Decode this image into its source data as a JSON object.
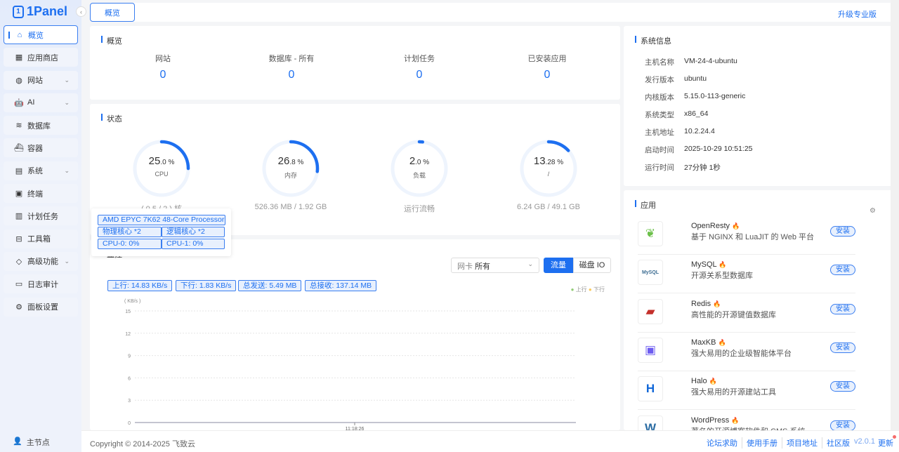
{
  "brand": "1Panel",
  "sidebar": {
    "items": [
      {
        "label": "概览",
        "icon": "home-icon"
      },
      {
        "label": "应用商店",
        "icon": "grid-icon"
      },
      {
        "label": "网站",
        "icon": "globe-icon",
        "expand": true
      },
      {
        "label": "AI",
        "icon": "robot-icon",
        "expand": true
      },
      {
        "label": "数据库",
        "icon": "database-icon"
      },
      {
        "label": "容器",
        "icon": "docker-icon"
      },
      {
        "label": "系统",
        "icon": "system-icon",
        "expand": true
      },
      {
        "label": "终端",
        "icon": "terminal-icon"
      },
      {
        "label": "计划任务",
        "icon": "calendar-icon"
      },
      {
        "label": "工具箱",
        "icon": "toolbox-icon"
      },
      {
        "label": "高级功能",
        "icon": "diamond-icon",
        "expand": true
      },
      {
        "label": "日志审计",
        "icon": "log-icon"
      },
      {
        "label": "面板设置",
        "icon": "gear-icon"
      }
    ],
    "node": "主节点"
  },
  "topbar": {
    "tab": "概览",
    "upgrade": "升级专业版"
  },
  "overview": {
    "title": "概览",
    "stats": [
      {
        "label": "网站",
        "value": "0"
      },
      {
        "label": "数据库 - 所有",
        "value": "0"
      },
      {
        "label": "计划任务",
        "value": "0"
      },
      {
        "label": "已安装应用",
        "value": "0"
      }
    ]
  },
  "status": {
    "title": "状态",
    "gauges": [
      {
        "int": "25",
        "dec": ".0 %",
        "label": "CPU",
        "sub": "( 0.5 / 2 ) 核",
        "percent": 25
      },
      {
        "int": "26",
        "dec": ".8 %",
        "label": "内存",
        "sub": "526.36 MB / 1.92 GB",
        "percent": 26.8
      },
      {
        "int": "2",
        "dec": ".0 %",
        "label": "负载",
        "sub": "运行流畅",
        "percent": 2
      },
      {
        "int": "13",
        "dec": ".28 %",
        "label": "/",
        "sub": "6.24 GB / 49.1 GB",
        "percent": 13.28
      }
    ],
    "accent": "#1d6ff0"
  },
  "cpu_tooltip": {
    "model": "AMD EPYC 7K62 48-Core Processor",
    "physical": "物理核心 *2",
    "logical": "逻辑核心 *2",
    "cpu0": "CPU-0: 0%",
    "cpu1": "CPU-1: 0%"
  },
  "monitor": {
    "title": "监控",
    "nic_label": "网卡",
    "nic_value": "所有",
    "btn_traffic": "流量",
    "btn_disk": "磁盘 IO",
    "tags": [
      "上行: 14.83 KB/s",
      "下行: 1.83 KB/s",
      "总发送: 5.49 MB",
      "总接收: 137.14 MB"
    ]
  },
  "chart_data": {
    "type": "line",
    "ylabel": "( KB/s )",
    "ylim": [
      0,
      15
    ],
    "yticks": [
      "15",
      "12",
      "9",
      "6",
      "3",
      "0"
    ],
    "x": [
      "11:18:26"
    ],
    "series": [
      {
        "name": "上行",
        "values": [
          0
        ],
        "color": "#91cc75"
      },
      {
        "name": "下行",
        "values": [
          0
        ],
        "color": "#fac858"
      }
    ],
    "grid": true,
    "legend": "top-right"
  },
  "sysinfo": {
    "title": "系统信息",
    "rows": [
      {
        "k": "主机名称",
        "v": "VM-24-4-ubuntu"
      },
      {
        "k": "发行版本",
        "v": "ubuntu"
      },
      {
        "k": "内核版本",
        "v": "5.15.0-113-generic"
      },
      {
        "k": "系统类型",
        "v": "x86_64"
      },
      {
        "k": "主机地址",
        "v": "10.2.24.4"
      },
      {
        "k": "启动时间",
        "v": "2025-10-29 10:51:25"
      },
      {
        "k": "运行时间",
        "v": "27分钟 1秒"
      }
    ]
  },
  "apps": {
    "title": "应用",
    "install": "安装",
    "items": [
      {
        "name": "OpenResty",
        "desc": "基于 NGINX 和 LuaJIT 的 Web 平台"
      },
      {
        "name": "MySQL",
        "desc": "开源关系型数据库"
      },
      {
        "name": "Redis",
        "desc": "高性能的开源键值数据库"
      },
      {
        "name": "MaxKB",
        "desc": "强大易用的企业级智能体平台"
      },
      {
        "name": "Halo",
        "desc": "强大易用的开源建站工具"
      },
      {
        "name": "WordPress",
        "desc": "著名的开源博客软件和 CMS 系统"
      }
    ]
  },
  "footer": {
    "copyright": "Copyright © 2014-2025 飞致云",
    "links": [
      "论坛求助",
      "使用手册",
      "项目地址",
      "社区版"
    ],
    "version": "v2.0.1",
    "update": "更新"
  }
}
